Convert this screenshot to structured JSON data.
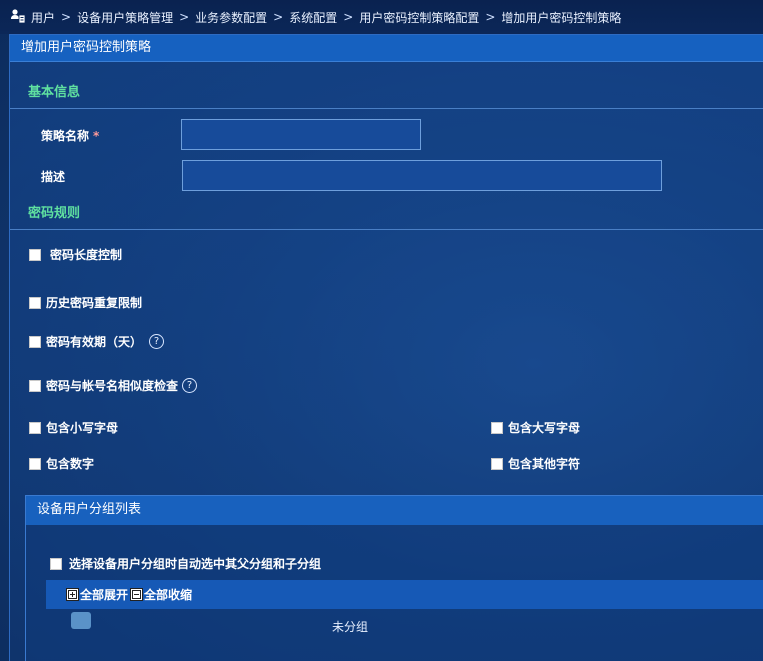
{
  "breadcrumb": {
    "items": [
      "用户",
      "设备用户策略管理",
      "业务参数配置",
      "系统配置",
      "用户密码控制策略配置",
      "增加用户密码控制策略"
    ],
    "separator": ">"
  },
  "panel": {
    "title": "增加用户密码控制策略"
  },
  "basic_info": {
    "section_title": "基本信息",
    "name_label": "策略名称",
    "required_mark": "*",
    "name_value": "",
    "desc_label": "描述",
    "desc_value": ""
  },
  "password_rules": {
    "section_title": "密码规则",
    "length_control": "密码长度控制",
    "history_limit": "历史密码重复限制",
    "validity_days": "密码有效期（天）",
    "similarity_check": "密码与帐号名相似度检查",
    "lowercase": "包含小写字母",
    "uppercase": "包含大写字母",
    "digits": "包含数字",
    "other_chars": "包含其他字符",
    "help_glyph": "?"
  },
  "group_list": {
    "title": "设备用户分组列表",
    "auto_select_label": "选择设备用户分组时自动选中其父分组和子分组",
    "expand_all": "全部展开",
    "collapse_all": "全部收缩",
    "tree_nodes": [
      "未分组"
    ]
  },
  "icons": {
    "breadcrumb": "user-group-icon",
    "help": "question-circle-icon",
    "expand": "plus-box-icon",
    "collapse": "minus-box-icon",
    "folder": "folder-icon"
  },
  "colors": {
    "section_title": "#5fe0a0",
    "panel_header": "#1661c0",
    "background": "#123a74"
  }
}
